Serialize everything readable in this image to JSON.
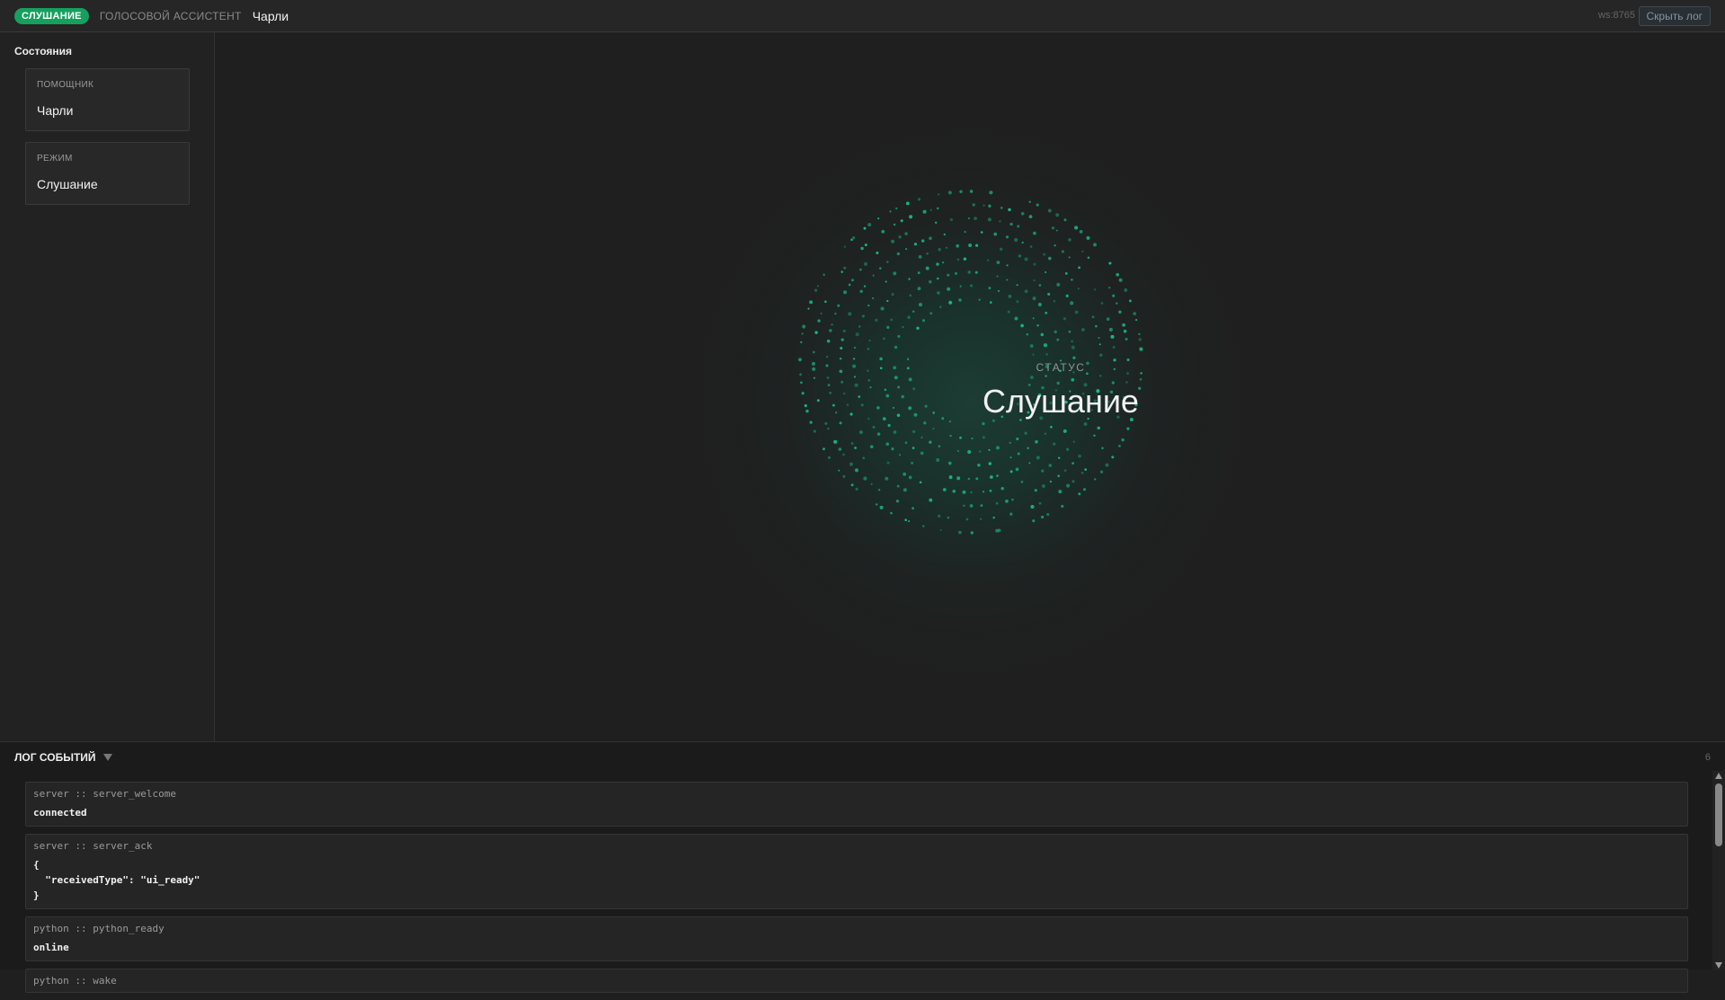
{
  "topbar": {
    "status_pill": "СЛУШАНИЕ",
    "app_subtitle": "ГОЛОСОВОЙ АССИСТЕНТ",
    "assistant_name": "Чарли",
    "ws_label": "ws:8765",
    "hide_log_label": "Скрыть лог"
  },
  "sidebar": {
    "title": "Состояния",
    "cards": [
      {
        "label": "ПОМОЩНИК",
        "value": "Чарли"
      },
      {
        "label": "РЕЖИМ",
        "value": "Слушание"
      }
    ]
  },
  "main": {
    "status_label": "СТАТУС",
    "status_value": "Слушание",
    "accent_color": "#19c08a"
  },
  "log": {
    "title": "ЛОГ СОБЫТИЙ",
    "count": "6",
    "entries": [
      {
        "source": "server :: server_welcome",
        "message": "connected"
      },
      {
        "source": "server :: server_ack",
        "message": "{\n  \"receivedType\": \"ui_ready\"\n}"
      },
      {
        "source": "python :: python_ready",
        "message": "online"
      },
      {
        "source": "python :: wake",
        "message": ""
      }
    ]
  }
}
